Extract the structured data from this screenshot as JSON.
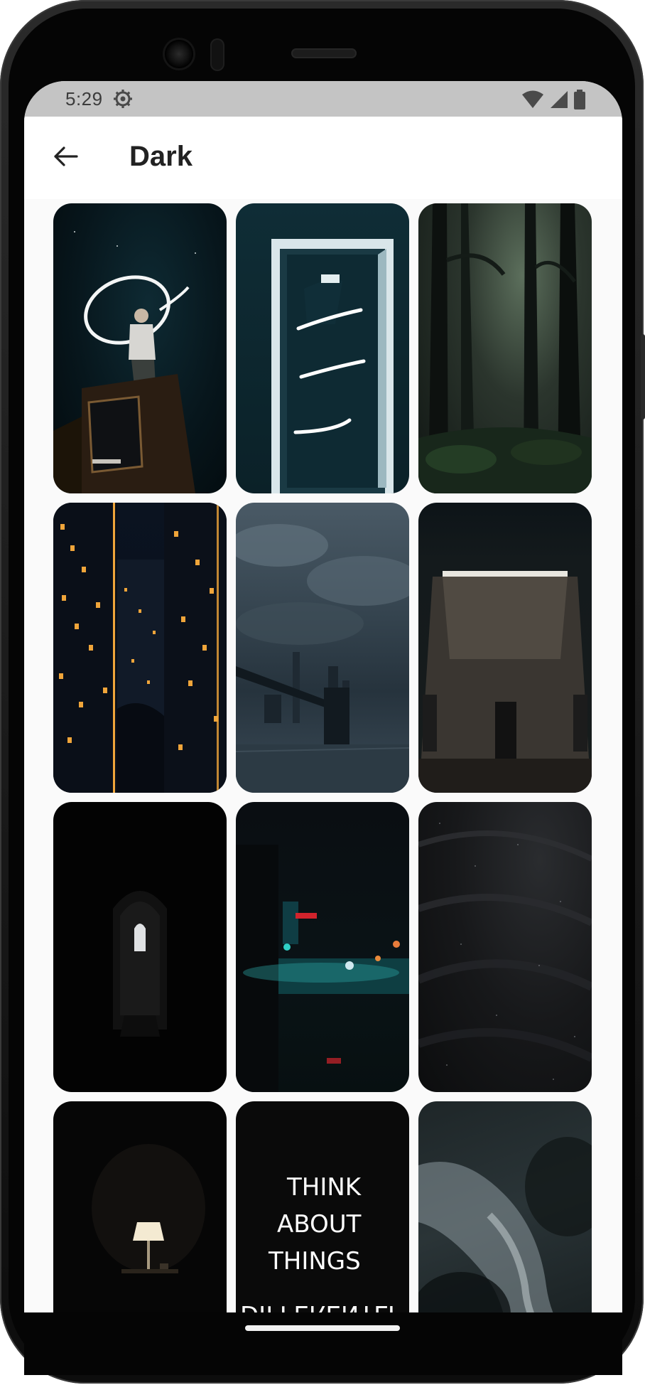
{
  "status_bar": {
    "time": "5:29",
    "icons": [
      "gear-icon",
      "wifi-icon",
      "cell-signal-icon",
      "battery-icon"
    ]
  },
  "app_bar": {
    "back_icon": "arrow-left-icon",
    "title": "Dark"
  },
  "wallpapers": [
    {
      "subject": "man-with-light-halo"
    },
    {
      "subject": "glowing-doorway"
    },
    {
      "subject": "misty-forest"
    },
    {
      "subject": "city-skyscrapers-night"
    },
    {
      "subject": "bridge-stormy-sky"
    },
    {
      "subject": "lit-concrete-wall"
    },
    {
      "subject": "dark-gothic-corridor"
    },
    {
      "subject": "neon-street-night"
    },
    {
      "subject": "black-sand-dunes"
    },
    {
      "subject": "table-lamp-dark"
    },
    {
      "subject": "neon-sign",
      "sign_lines": [
        "THINK",
        "ABOUT",
        "THINGS",
        "DIFFERENTLY"
      ]
    },
    {
      "subject": "dark-clouds"
    }
  ],
  "colors": {
    "status_bar_bg": "#c4c4c4",
    "app_bar_bg": "#ffffff",
    "screen_bg": "#fafafa",
    "title_text": "#222222"
  }
}
